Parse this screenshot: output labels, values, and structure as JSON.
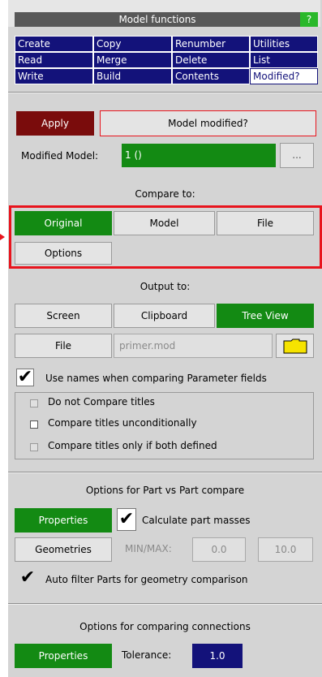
{
  "header": {
    "title": "Model functions",
    "help_label": "?"
  },
  "menu": [
    [
      "Create",
      "Copy",
      "Renumber",
      "Utilities"
    ],
    [
      "Read",
      "Merge",
      "Delete",
      "List"
    ],
    [
      "Write",
      "Build",
      "Contents",
      "Modified?"
    ]
  ],
  "apply_label": "Apply",
  "status_text": "Model modified?",
  "modified_model": {
    "label": "Modified Model:",
    "value": "1 ()",
    "browse_label": "..."
  },
  "compare": {
    "heading": "Compare to:",
    "original": "Original",
    "model": "Model",
    "file": "File",
    "options": "Options"
  },
  "output": {
    "heading": "Output to:",
    "screen": "Screen",
    "clipboard": "Clipboard",
    "tree_view": "Tree View",
    "file": "File",
    "filename": "primer.mod"
  },
  "use_names_label": "Use names when comparing Parameter fields",
  "titles": {
    "do_not": "Do not Compare titles",
    "unconditional": "Compare titles unconditionally",
    "both_defined": "Compare titles only if both defined"
  },
  "part_compare": {
    "heading": "Options for Part vs Part compare",
    "properties": "Properties",
    "calc_masses": "Calculate part masses",
    "geometries": "Geometries",
    "minmax_label": "MIN/MAX:",
    "min": "0.0",
    "max": "10.0",
    "auto_filter": "Auto filter Parts for geometry comparison"
  },
  "connections": {
    "heading": "Options for comparing connections",
    "properties": "Properties",
    "tolerance_label": "Tolerance:",
    "tolerance": "1.0"
  },
  "colors": {
    "accent_green": "#138a13",
    "menu_blue": "#13127a",
    "apply_red": "#7a0c0c",
    "highlight_red": "#e8141d"
  }
}
